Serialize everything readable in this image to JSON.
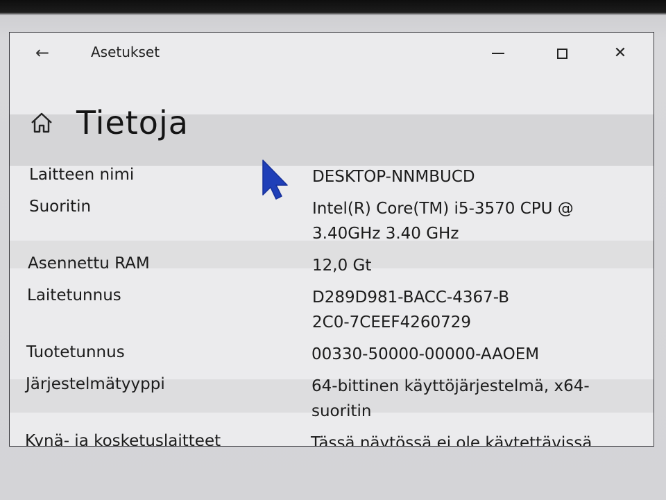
{
  "window": {
    "app_title": "Asetukset",
    "back_label": "←",
    "close_label": "✕"
  },
  "page": {
    "title": "Tietoja"
  },
  "specs": [
    {
      "label": "Laitteen nimi",
      "value": "DESKTOP-NNMBUCD"
    },
    {
      "label": "Suoritin",
      "value": "Intel(R) Core(TM) i5-3570 CPU @ 3.40GHz   3.40 GHz"
    },
    {
      "label": "Asennettu RAM",
      "value": "12,0 Gt"
    },
    {
      "label": "Laitetunnus",
      "value": "D289D981-BACC-4367-B2C0-7CEEF4260729"
    },
    {
      "label": "Tuotetunnus",
      "value": "00330-50000-00000-AAOEM"
    },
    {
      "label": "Järjestelmätyyppi",
      "value": "64-bittinen käyttöjärjestelmä, x64-suoritin"
    },
    {
      "label": "Kynä- ja kosketuslaitteet",
      "value": "Tässä näytössä ei ole käytettävissä"
    }
  ],
  "icons": {
    "back": "back-arrow-icon",
    "home": "home-icon",
    "cursor": "mouse-pointer-icon"
  },
  "colors": {
    "cursor": "#1f3fb8",
    "window_bg": "#ebebed",
    "text": "#1b1b1b"
  }
}
